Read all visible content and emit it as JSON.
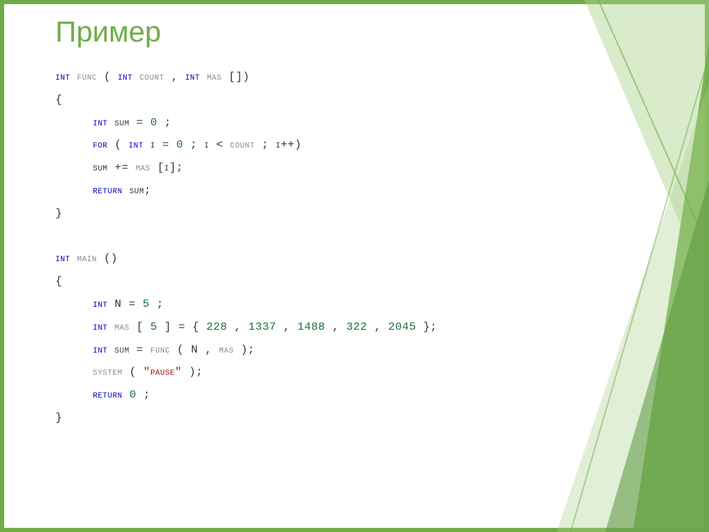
{
  "title": "Пример",
  "code": {
    "l1": {
      "t1": "int",
      "t2": "func",
      "t3": "(",
      "t4": "int",
      "t5": "count",
      "t6": ", ",
      "t7": "int",
      "t8": "mas",
      "t9": "[])"
    },
    "l2": "{",
    "l3": {
      "t1": "int",
      "t2": "sum = ",
      "t3": "0",
      "t4": ";"
    },
    "l4": {
      "t1": "for",
      "t2": " (",
      "t3": "int",
      "t4": " i = ",
      "t5": "0",
      "t6": "; i < ",
      "t7": "count",
      "t8": "; i++)"
    },
    "l5": {
      "t1": "sum += ",
      "t2": "mas",
      "t3": "[i];"
    },
    "l6": {
      "t1": "return",
      "t2": " sum;"
    },
    "l7": "}",
    "l8": {
      "t1": "int",
      "t2": "main",
      "t3": "()"
    },
    "l9": "{",
    "l10": {
      "t1": "int",
      "t2": "N",
      "t3": " = ",
      "t4": "5",
      "t5": ";"
    },
    "l11": {
      "t1": "int",
      "t2": "mas",
      "t3": "[",
      "t4": "5",
      "t5": "] = { ",
      "t6": "228",
      "t7": ", ",
      "t8": "1337",
      "t9": ", ",
      "t10": "1488",
      "t11": ", ",
      "t12": "322",
      "t13": ", ",
      "t14": "2045",
      "t15": " };"
    },
    "l12": {
      "t1": "int",
      "t2": " sum = ",
      "t3": "func",
      "t4": "(",
      "t5": "N",
      "t6": ", ",
      "t7": "mas",
      "t8": ");"
    },
    "l13": {
      "t1": "system",
      "t2": "(",
      "t3": "\"pause\"",
      "t4": ");"
    },
    "l14": {
      "t1": "return",
      "t2": " ",
      "t3": "0",
      "t4": ";"
    },
    "l15": "}"
  }
}
